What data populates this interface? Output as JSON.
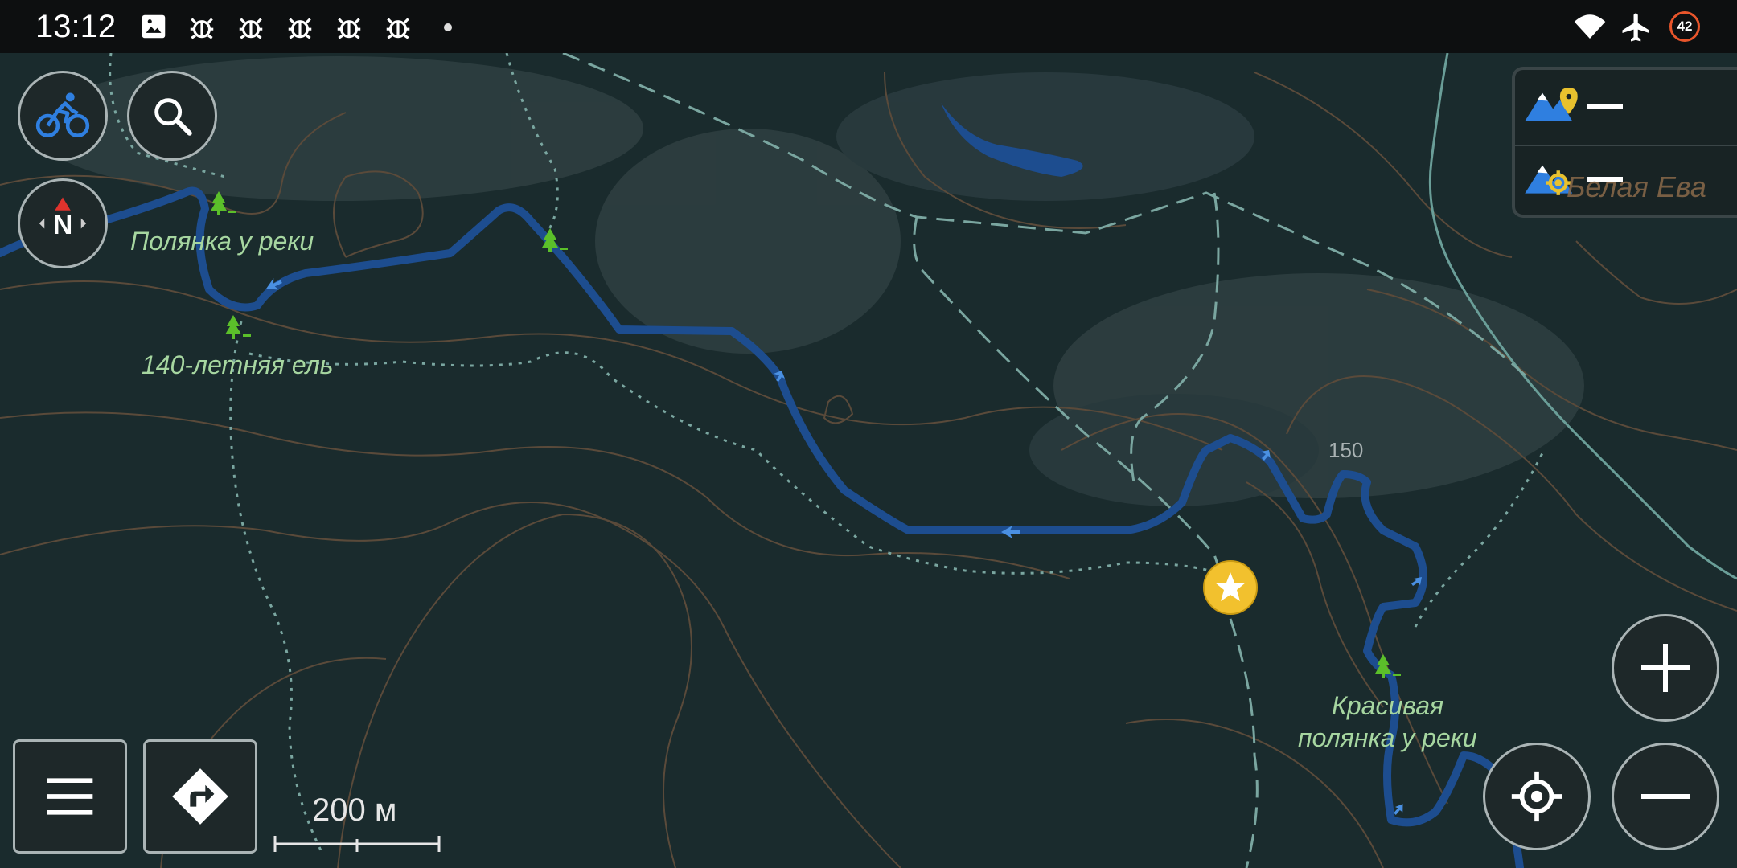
{
  "status_bar": {
    "time": "13:12",
    "notification_icons": [
      "image-icon",
      "android-debug-icon",
      "android-debug-icon",
      "android-debug-icon",
      "android-debug-icon",
      "android-debug-icon"
    ],
    "right_icons": [
      "wifi-icon",
      "airplane-mode-icon"
    ],
    "battery_level": "42"
  },
  "map": {
    "colors": {
      "background": "#1a2b2d",
      "route": "#1d4d8f",
      "route_arrow": "#4a90e2",
      "contour": "#5a4a3a",
      "dashed_track": "#7aa6a0",
      "water": "#1d4d8f",
      "poi_tree": "#5bbf2a",
      "favorite": "#f2c12e"
    },
    "labels": {
      "poi_1": "Полянка у реки",
      "poi_2": "140-летняя ель",
      "poi_3_line1": "Красивая",
      "poi_3_line2": "полянка у реки",
      "contour_elevation": "150",
      "peak_name": "Белая Ева"
    },
    "scale": {
      "text": "200 м"
    }
  },
  "controls": {
    "profile_icon": "bicycle-icon",
    "search_icon": "search-icon",
    "compass_letter": "N",
    "menu_icon": "menu-icon",
    "directions_icon": "directions-icon",
    "zoom_in_icon": "plus-icon",
    "zoom_out_icon": "minus-icon",
    "my_location_icon": "my-location-icon"
  },
  "layer_panel": {
    "row1_icon": "mountain-pin-icon",
    "row2_icon": "mountain-location-icon"
  }
}
